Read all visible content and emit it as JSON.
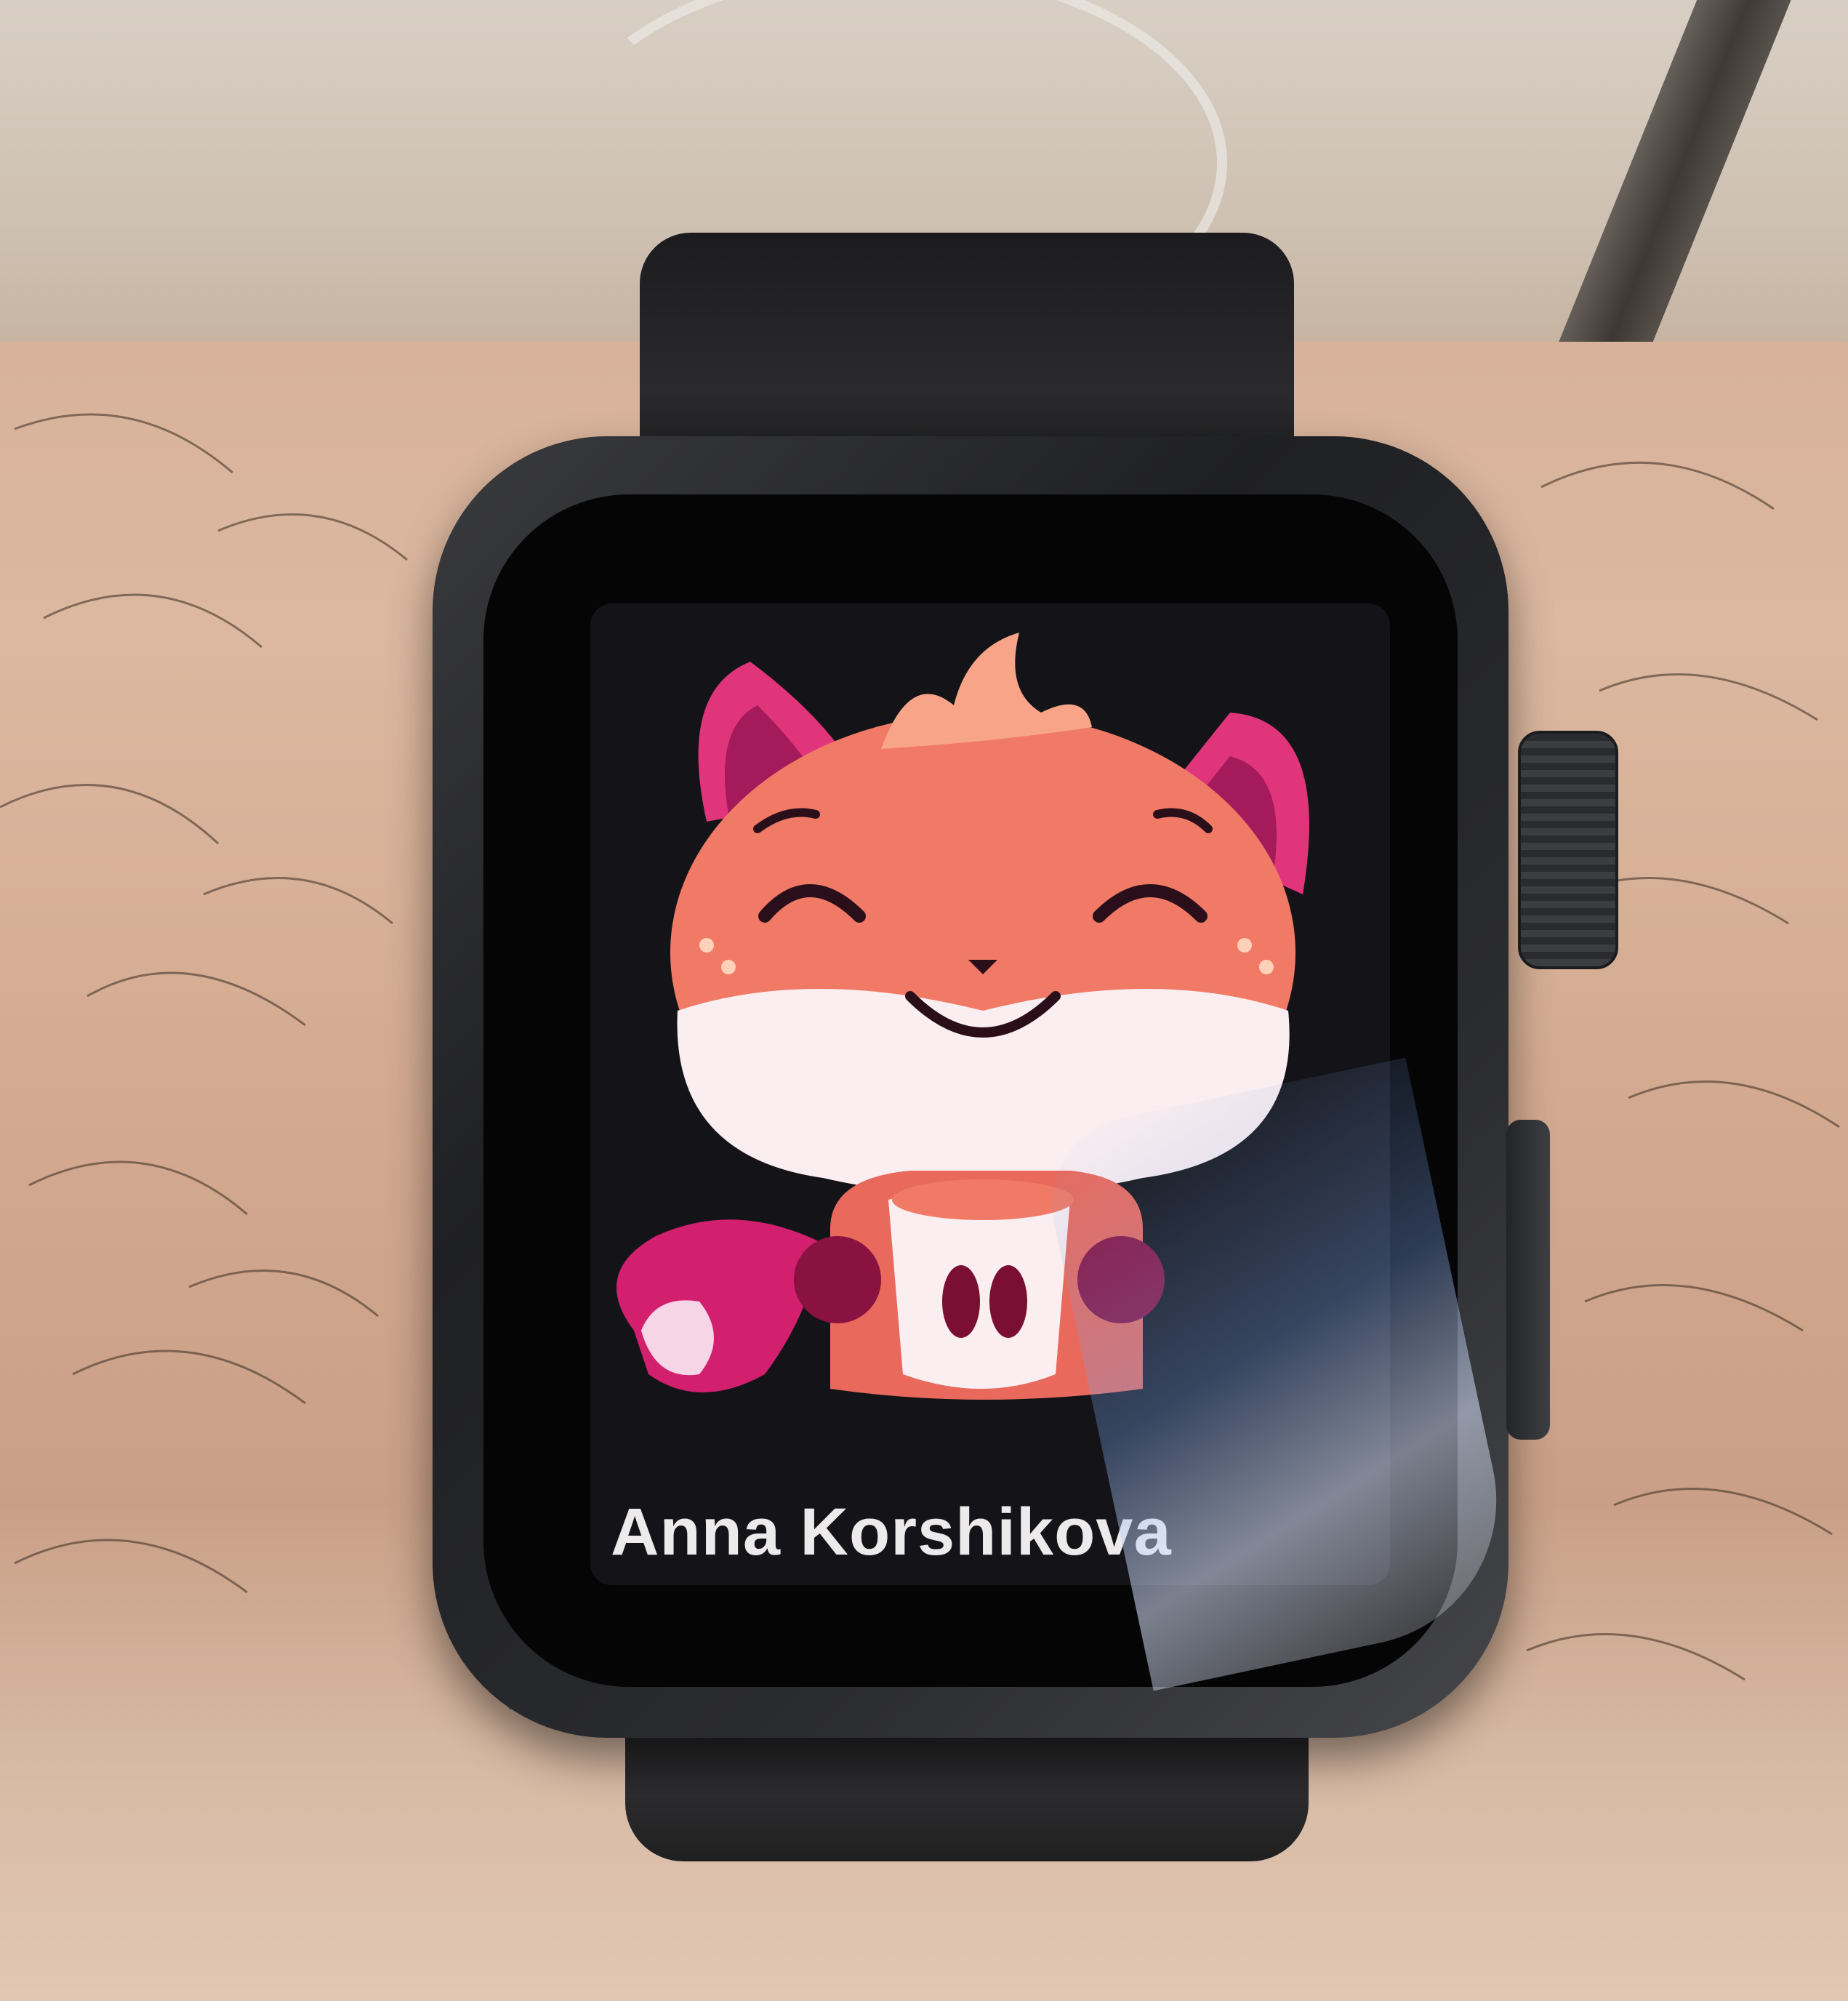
{
  "screen": {
    "sender_name": "Anna Korshikova",
    "sticker": "fox-holding-coffee-cup-sticker"
  },
  "colors": {
    "screen_background": "#141418",
    "fox_orange": "#f07a66",
    "fox_pink": "#e0357a",
    "fox_magenta": "#b0155c",
    "fox_white": "#fbeef0",
    "text": "#eceaea"
  }
}
